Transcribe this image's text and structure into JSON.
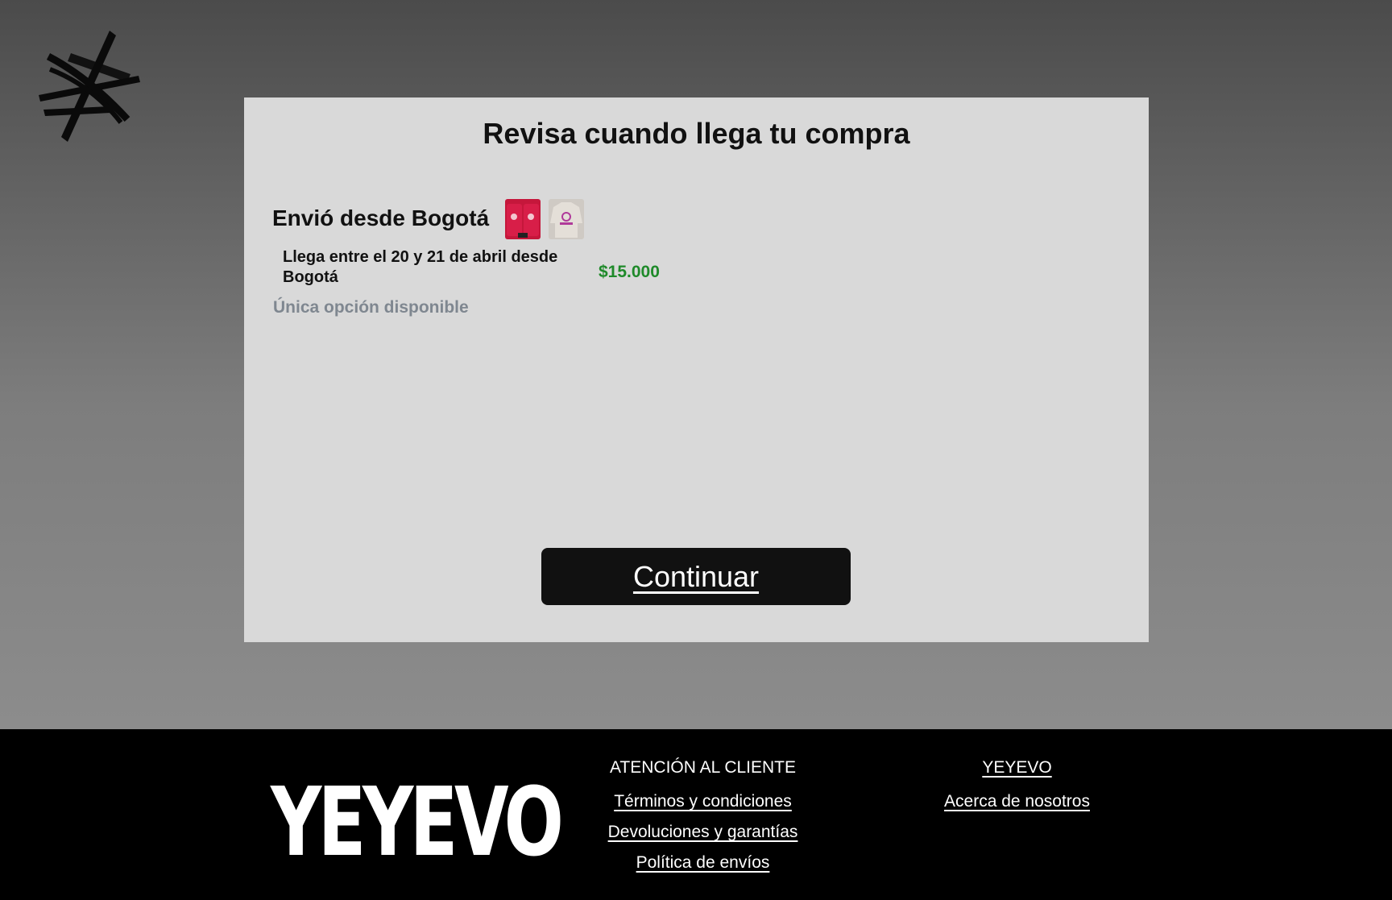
{
  "modal": {
    "title": "Revisa cuando llega tu compra",
    "shipping_heading": "Envió desde Bogotá",
    "arrival_text": "Llega entre el 20 y 21 de abril desde Bogotá",
    "price": "$15.000",
    "availability": "Única opción disponible",
    "continue_label": "Continuar"
  },
  "footer": {
    "brand": "YEYEVO",
    "customer_service": {
      "heading": "ATENCIÓN AL CLIENTE",
      "links": [
        "Términos y condiciones",
        "Devoluciones y garantías",
        "Política de envíos"
      ]
    },
    "company": {
      "heading": "YEYEVO",
      "links": [
        "Acerca de nosotros"
      ]
    }
  },
  "colors": {
    "price": "#1f8a2a",
    "button": "#111111",
    "modal_bg": "#d9d9d9",
    "footer_bg": "#000000"
  }
}
